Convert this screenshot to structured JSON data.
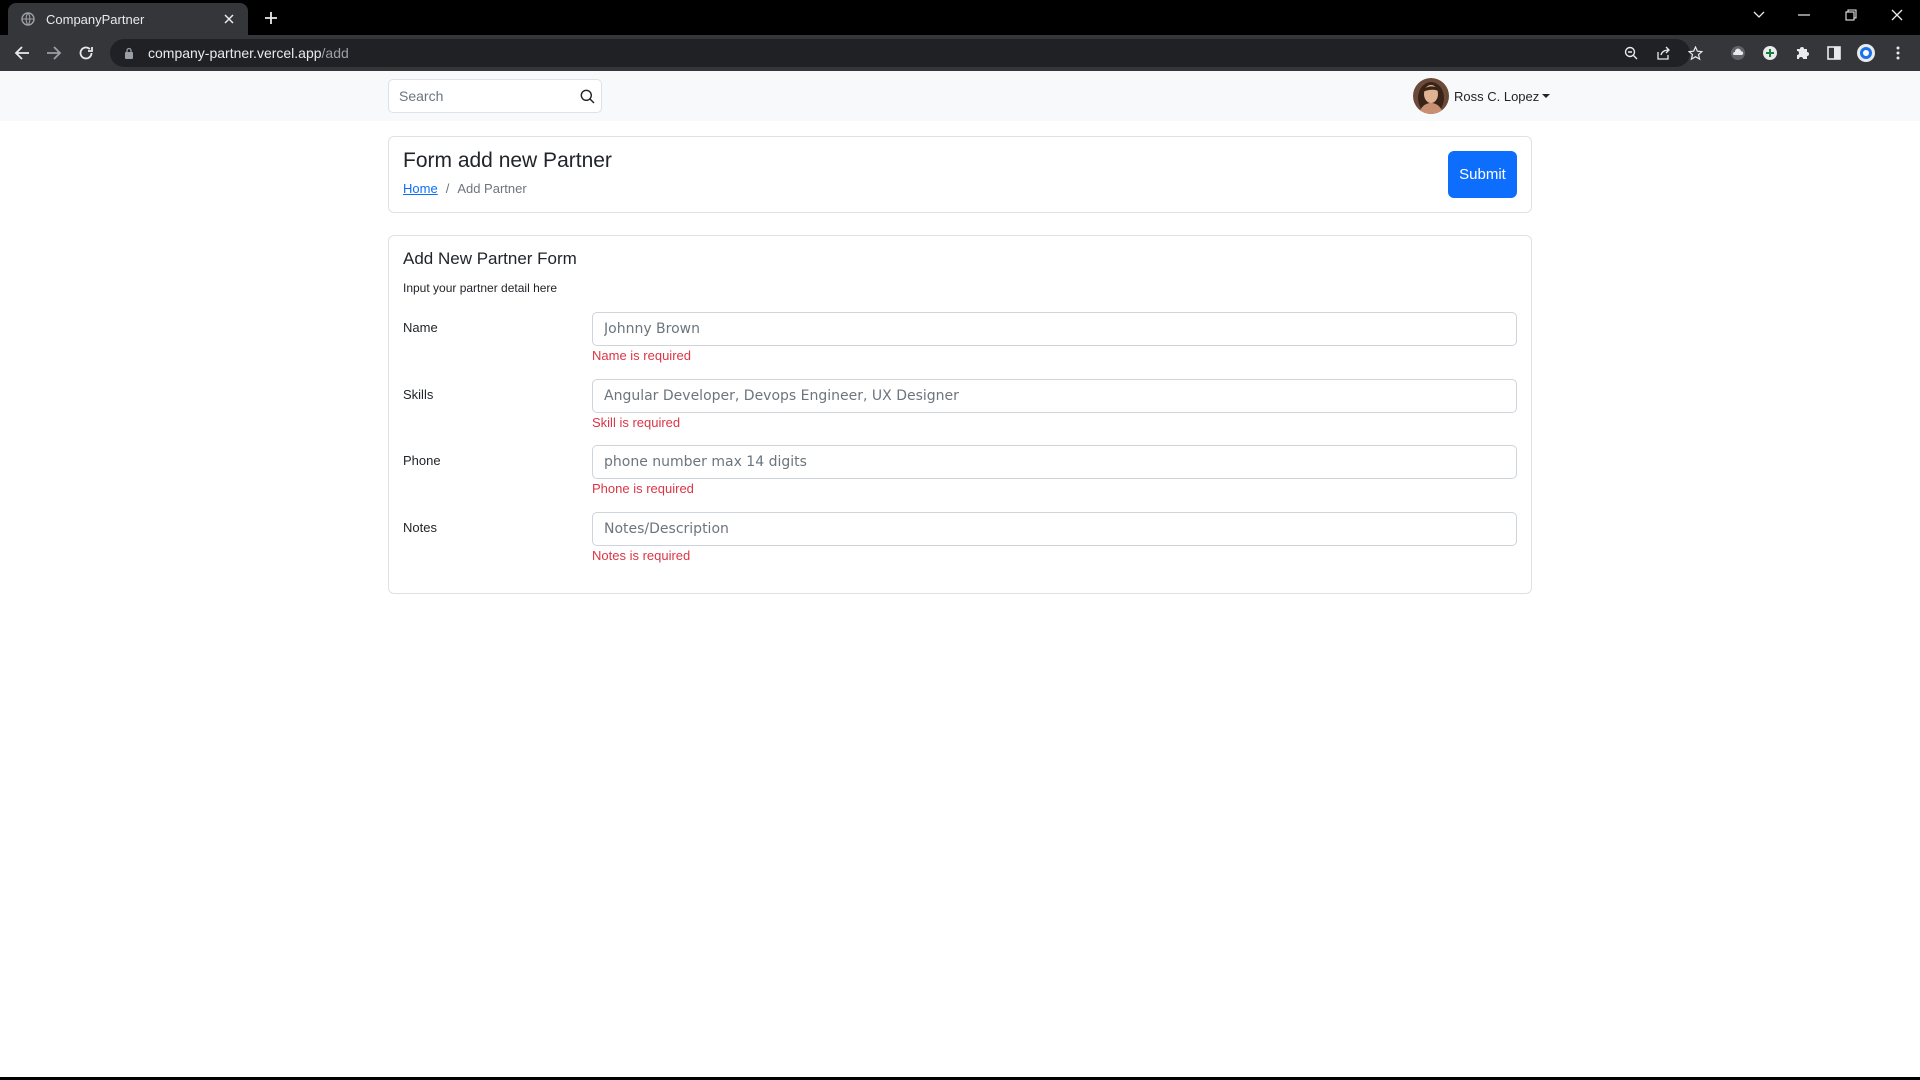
{
  "browser": {
    "tab_title": "CompanyPartner",
    "url_domain": "company-partner.vercel.app",
    "url_path": "/add"
  },
  "navbar": {
    "search_placeholder": "Search",
    "user_name": "Ross C. Lopez"
  },
  "header": {
    "title": "Form add new Partner",
    "breadcrumb": {
      "home": "Home",
      "separator": "/",
      "current": "Add Partner"
    },
    "submit_label": "Submit"
  },
  "form": {
    "title": "Add New Partner Form",
    "subtitle": "Input your partner detail here",
    "fields": [
      {
        "label": "Name",
        "placeholder": "Johnny Brown",
        "value": "",
        "error": "Name is required"
      },
      {
        "label": "Skills",
        "placeholder": "Angular Developer, Devops Engineer, UX Designer",
        "value": "",
        "error": "Skill is required"
      },
      {
        "label": "Phone",
        "placeholder": "phone number max 14 digits",
        "value": "",
        "error": "Phone is required"
      },
      {
        "label": "Notes",
        "placeholder": "Notes/Description",
        "value": "",
        "error": "Notes is required"
      }
    ]
  },
  "colors": {
    "primary": "#0d6efd",
    "error": "#dc3545",
    "navbar_bg": "#f8f9fa",
    "chrome_dark": "#35363a"
  }
}
